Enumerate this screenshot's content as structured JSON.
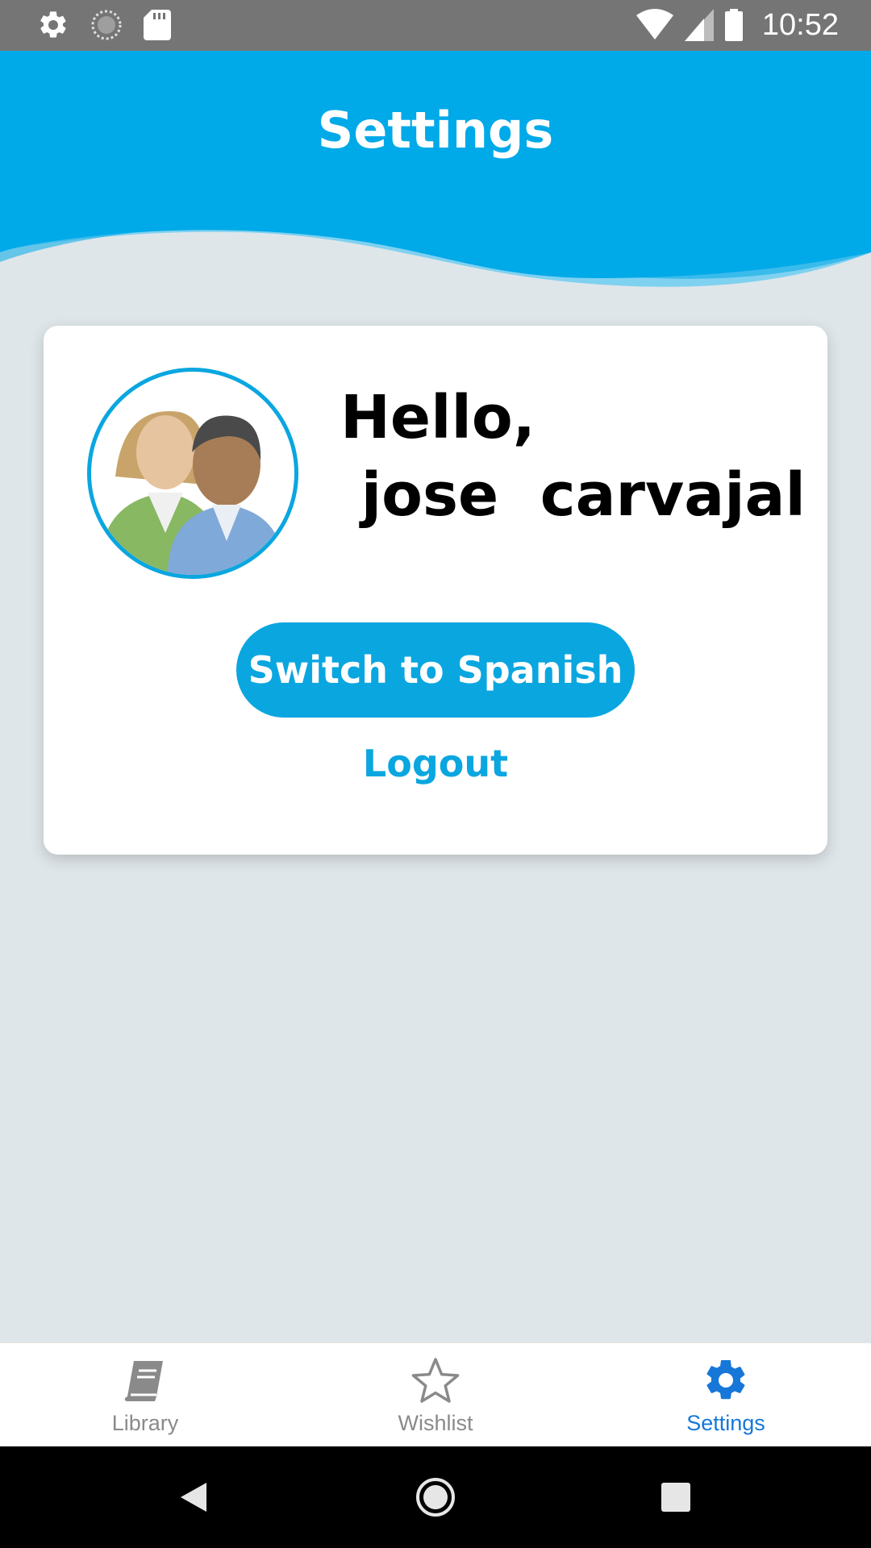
{
  "status_bar": {
    "time": "10:52",
    "left_icons": [
      "gear-icon",
      "sync-icon",
      "sd-card-icon"
    ],
    "right_icons": [
      "wifi-icon",
      "signal-icon",
      "battery-icon"
    ]
  },
  "header": {
    "title": "Settings",
    "color": "#00a9e8"
  },
  "profile": {
    "avatar_icon": "users-icon",
    "greeting": "Hello,\n jose  carvajal"
  },
  "actions": {
    "switch_language_label": "Switch to Spanish",
    "logout_label": "Logout",
    "accent": "#0aa6e0"
  },
  "bottom_nav": {
    "items": [
      {
        "label": "Library",
        "icon": "book-icon",
        "active": false
      },
      {
        "label": "Wishlist",
        "icon": "star-icon",
        "active": false
      },
      {
        "label": "Settings",
        "icon": "gear-icon",
        "active": true
      }
    ],
    "active_color": "#1677d9",
    "inactive_color": "#8a8a8a"
  },
  "system_nav": {
    "buttons": [
      "back-icon",
      "home-icon",
      "recents-icon"
    ]
  }
}
